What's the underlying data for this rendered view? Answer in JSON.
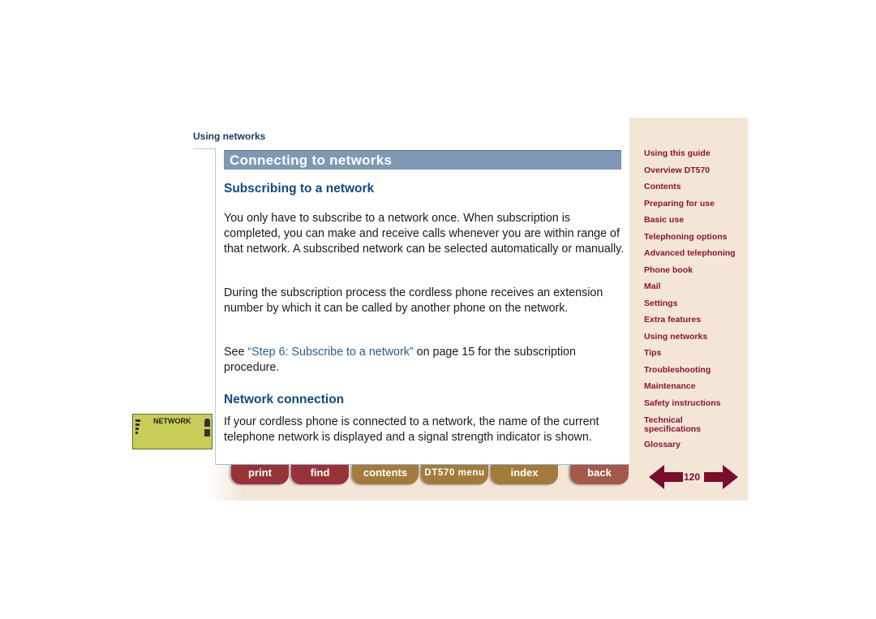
{
  "breadcrumb": "Using networks",
  "section_title": "Connecting to networks",
  "sections": [
    {
      "heading": "Subscribing to a network",
      "paragraphs": [
        "You only have to subscribe to a network once. When subscription is completed, you can make and receive calls whenever you are within range of that network. A subscribed network can be selected automatically or manually.",
        "During the subscription process the cordless phone receives an extension number by which it can be called by another phone on the network."
      ],
      "see_also": {
        "prefix": "See ",
        "link_text": "“Step 6: Subscribe to a network”",
        "suffix": " on page 15 for the subscription procedure."
      }
    },
    {
      "heading": "Network connection",
      "paragraphs": [
        "If your cordless phone is connected to a network, the name of the current telephone network is displayed and a signal strength indicator is shown."
      ]
    }
  ],
  "display": {
    "text": "NETWORK"
  },
  "sidebar": {
    "items": [
      {
        "label": "Using this guide"
      },
      {
        "label": "Overview DT570"
      },
      {
        "label": "Contents"
      },
      {
        "label": "Preparing for use"
      },
      {
        "label": "Basic use"
      },
      {
        "label": "Telephoning options"
      },
      {
        "label": "Advanced telephoning"
      },
      {
        "label": "Phone book"
      },
      {
        "label": "Mail"
      },
      {
        "label": "Settings"
      },
      {
        "label": "Extra features"
      },
      {
        "label": "Using networks"
      },
      {
        "label": "Tips"
      },
      {
        "label": "Troubleshooting"
      },
      {
        "label": "Maintenance"
      },
      {
        "label": "Safety instructions"
      },
      {
        "label": "Technical specifications"
      },
      {
        "label": "Glossary"
      }
    ]
  },
  "toolbar": {
    "print": "print",
    "find": "find",
    "contents": "contents",
    "menu": "DT570 menu",
    "index": "index",
    "back": "back"
  },
  "pager": {
    "page": "120",
    "prev_icon": "arrow-left-icon",
    "next_icon": "arrow-right-icon"
  },
  "colors": {
    "title_bar": "#7f98b4",
    "heading": "#134a7c",
    "nav_text": "#8a1436",
    "sidebar_bg": "#f3e6d6",
    "button_red": "#963338",
    "button_gold": "#a37b3c",
    "button_back": "#a35a4a",
    "lcd": "#c8cc58"
  }
}
